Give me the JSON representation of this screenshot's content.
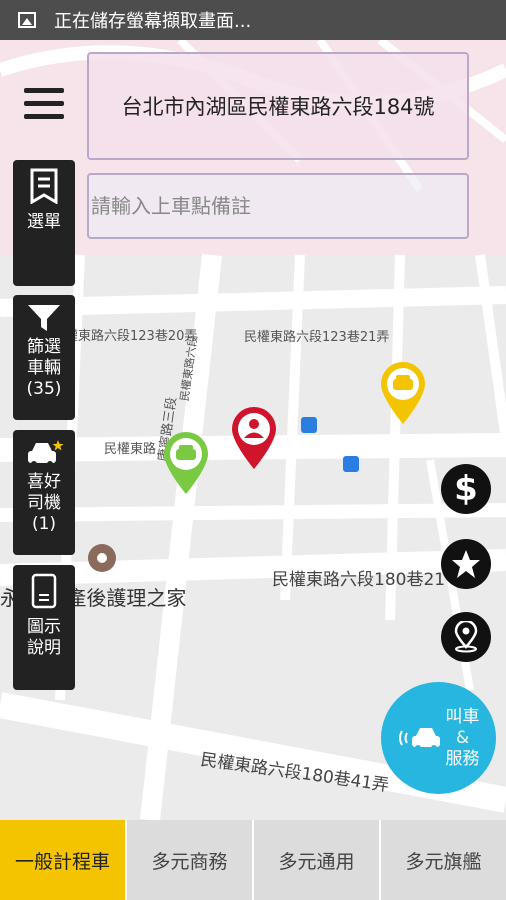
{
  "status_bar": {
    "text": "正在儲存螢幕擷取畫面..."
  },
  "address": {
    "value": "台北市內湖區民權東路六段184號"
  },
  "note": {
    "placeholder": "請輸入上車點備註"
  },
  "side_menu": [
    {
      "label": "選單",
      "icon": "menu-list-icon"
    },
    {
      "label": "篩選\n車輛\n(35)",
      "icon": "filter-icon"
    },
    {
      "label": "喜好\n司機\n(1)",
      "icon": "favorite-car-icon"
    },
    {
      "label": "圖示\n說明",
      "icon": "phone-info-icon"
    }
  ],
  "map_labels": {
    "r1": "民權東路六段123巷20弄",
    "r2": "民權東路六段123巷21弄",
    "r3": "民權東路",
    "r4": "民權東路六段180巷21",
    "r5": "民權東路六段180巷41弄",
    "r6": "康寧路三段",
    "r7": "民權東路六段",
    "poi": "永安 馨產後護理之家"
  },
  "right_buttons": [
    "dollar-icon",
    "star-icon",
    "location-pin-icon"
  ],
  "call_button": {
    "label": "叫車\n&\n服務"
  },
  "tabs": [
    {
      "label": "一般計程車",
      "active": true
    },
    {
      "label": "多元商務",
      "active": false
    },
    {
      "label": "多元通用",
      "active": false
    },
    {
      "label": "多元旗艦",
      "active": false
    }
  ],
  "colors": {
    "accent": "#f5c400",
    "call": "#26b6e0",
    "pin_user": "#d0142c",
    "pin_green": "#7ac943",
    "pin_yellow": "#f5c400"
  }
}
